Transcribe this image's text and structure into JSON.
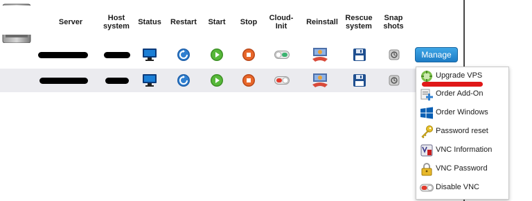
{
  "table": {
    "headers": [
      {
        "key": "server",
        "label": "Server"
      },
      {
        "key": "host",
        "label": "Host\nsystem"
      },
      {
        "key": "status",
        "label": "Status"
      },
      {
        "key": "restart",
        "label": "Restart"
      },
      {
        "key": "start",
        "label": "Start"
      },
      {
        "key": "stop",
        "label": "Stop"
      },
      {
        "key": "cloudinit",
        "label": "Cloud-\nInit"
      },
      {
        "key": "reinstall",
        "label": "Reinstall"
      },
      {
        "key": "rescue",
        "label": "Rescue\nsystem"
      },
      {
        "key": "snapshots",
        "label": "Snap\nshots"
      }
    ],
    "rows": [
      {
        "cloud_init": "on"
      },
      {
        "cloud_init": "off"
      }
    ]
  },
  "manage_button": {
    "label": "Manage"
  },
  "menu": {
    "items": [
      {
        "label": "Upgrade VPS",
        "icon": "upgrade-vps-icon"
      },
      {
        "label": "Order Add-On",
        "icon": "order-addon-icon"
      },
      {
        "label": "Order Windows",
        "icon": "windows-icon"
      },
      {
        "label": "Password reset",
        "icon": "key-icon"
      },
      {
        "label": "VNC Information",
        "icon": "vnc-info-icon"
      },
      {
        "label": "VNC Password",
        "icon": "padlock-icon"
      },
      {
        "label": "Disable VNC",
        "icon": "toggle-off-icon"
      }
    ]
  },
  "colors": {
    "accent": "#1d7dc6",
    "toggle_on": "#3cb371",
    "toggle_off": "#e23a2c",
    "redaction": "#e01818"
  }
}
